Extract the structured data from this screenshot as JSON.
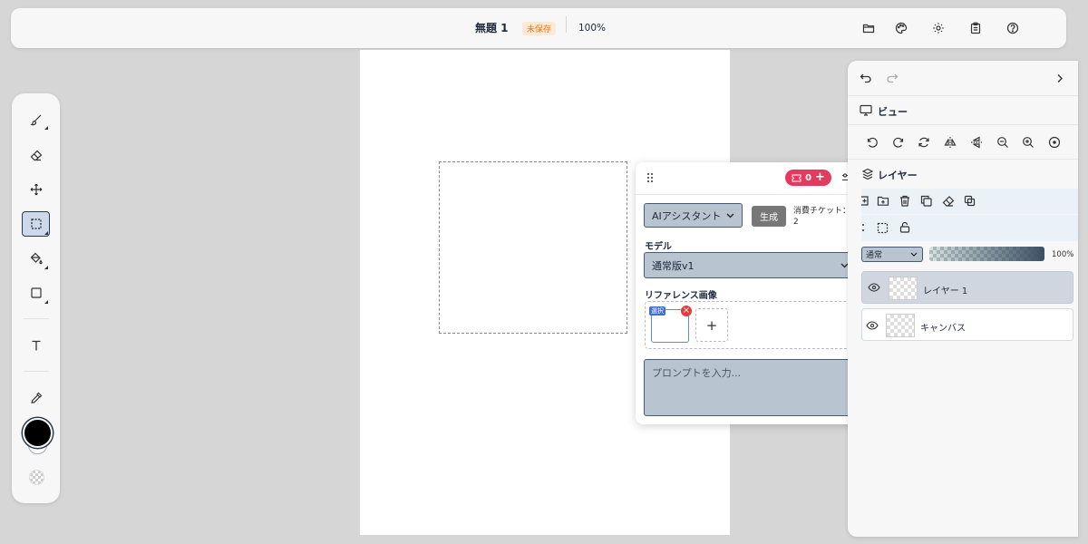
{
  "header": {
    "doc_title": "無題 1",
    "unsaved_badge": "未保存",
    "zoom": "100%",
    "icons": [
      "folder-icon",
      "palette-icon",
      "settings-icon",
      "clipboard-icon",
      "help-icon"
    ]
  },
  "toolbar": {
    "tools": [
      "brush-icon",
      "eraser-icon",
      "move-icon",
      "select-rect-icon",
      "fill-bucket-icon",
      "shape-icon",
      "text-icon",
      "eyedropper-icon"
    ],
    "active_tool": "select-rect-icon",
    "primary_color": "#000000",
    "secondary_color": "#ffffff"
  },
  "ai_panel": {
    "ticket_count": "0",
    "assistant_label": "AIアシスタント",
    "generate_label": "生成",
    "ticket_cost_label": "消費チケット：",
    "ticket_cost_value": "2",
    "model_label": "モデル",
    "model_value": "通常版v1",
    "reference_label": "リファレンス画像",
    "reference_tag": "選択",
    "add_reference": "+",
    "prompt_placeholder": "プロンプトを入力..."
  },
  "right_panel": {
    "view_title": "ビュー",
    "layer_title": "レイヤー",
    "blend_mode": "通常",
    "opacity": "100%",
    "layers": [
      {
        "name": "レイヤー 1",
        "active": true
      },
      {
        "name": "キャンバス",
        "active": false
      }
    ]
  },
  "colors": {
    "accent_ticket": "#e23b5e",
    "unsaved": "#e07b20",
    "select_fill": "#b8c4d0",
    "active_layer": "#cfd6df"
  }
}
